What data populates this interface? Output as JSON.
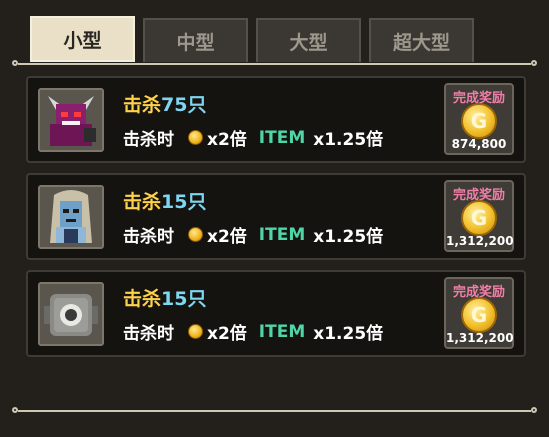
{
  "tabs": [
    {
      "label": "小型",
      "active": true
    },
    {
      "label": "中型",
      "active": false
    },
    {
      "label": "大型",
      "active": false
    },
    {
      "label": "超大型",
      "active": false
    }
  ],
  "entries": [
    {
      "kill_label": "击杀",
      "count_label": "75只",
      "when_label": "击杀时",
      "coin_mult": "x2倍",
      "item_label": "ITEM",
      "item_mult": "x1.25倍",
      "reward_label": "完成奖励",
      "reward_coin_glyph": "G",
      "reward_amount": "874,800",
      "portrait_icon": "demon-portrait-icon"
    },
    {
      "kill_label": "击杀",
      "count_label": "15只",
      "when_label": "击杀时",
      "coin_mult": "x2倍",
      "item_label": "ITEM",
      "item_mult": "x1.25倍",
      "reward_label": "完成奖励",
      "reward_coin_glyph": "G",
      "reward_amount": "1,312,200",
      "portrait_icon": "ghost-portrait-icon"
    },
    {
      "kill_label": "击杀",
      "count_label": "15只",
      "when_label": "击杀时",
      "coin_mult": "x2倍",
      "item_label": "ITEM",
      "item_mult": "x1.25倍",
      "reward_label": "完成奖励",
      "reward_coin_glyph": "G",
      "reward_amount": "1,312,200",
      "portrait_icon": "stone-eye-portrait-icon"
    }
  ],
  "colors": {
    "kill": "#ffd24a",
    "count": "#7ed6f0",
    "item": "#4fd6a8",
    "reward_label": "#ef7fa8"
  }
}
